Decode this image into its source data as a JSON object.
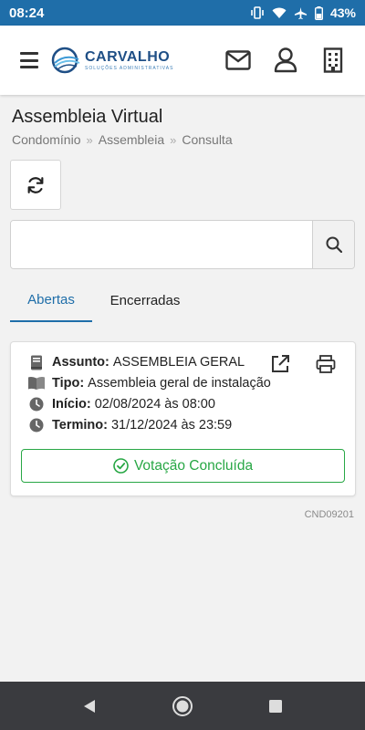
{
  "status_bar": {
    "time": "08:24",
    "battery": "43%"
  },
  "app_bar": {
    "logo_title": "CARVALHO",
    "logo_subtitle": "SOLUÇÕES ADMINISTRATIVAS"
  },
  "page": {
    "title": "Assembleia Virtual",
    "breadcrumb": [
      "Condomínio",
      "Assembleia",
      "Consulta"
    ]
  },
  "search": {
    "value": "",
    "placeholder": ""
  },
  "tabs": [
    {
      "label": "Abertas",
      "active": true
    },
    {
      "label": "Encerradas",
      "active": false
    }
  ],
  "card": {
    "assunto_label": "Assunto:",
    "assunto_value": "ASSEMBLEIA GERAL",
    "tipo_label": "Tipo:",
    "tipo_value": "Assembleia geral de instalação",
    "inicio_label": "Início:",
    "inicio_value": "02/08/2024 às 08:00",
    "termino_label": "Termino:",
    "termino_value": "31/12/2024 às 23:59",
    "status_label": "Votação Concluída"
  },
  "footer": {
    "code": "CND09201"
  },
  "colors": {
    "status_bar": "#1f6ea9",
    "accent": "#1f6ea9",
    "success": "#28a745",
    "nav_bar": "#3a3b3f"
  },
  "icons": [
    "vibrate-icon",
    "wifi-icon",
    "airplane-icon",
    "battery-icon",
    "menu-icon",
    "mail-icon",
    "user-icon",
    "building-icon",
    "refresh-icon",
    "search-icon",
    "book-icon",
    "open-book-icon",
    "clock-icon",
    "external-link-icon",
    "print-icon",
    "check-circle-icon",
    "back-icon",
    "home-icon",
    "recents-icon"
  ]
}
